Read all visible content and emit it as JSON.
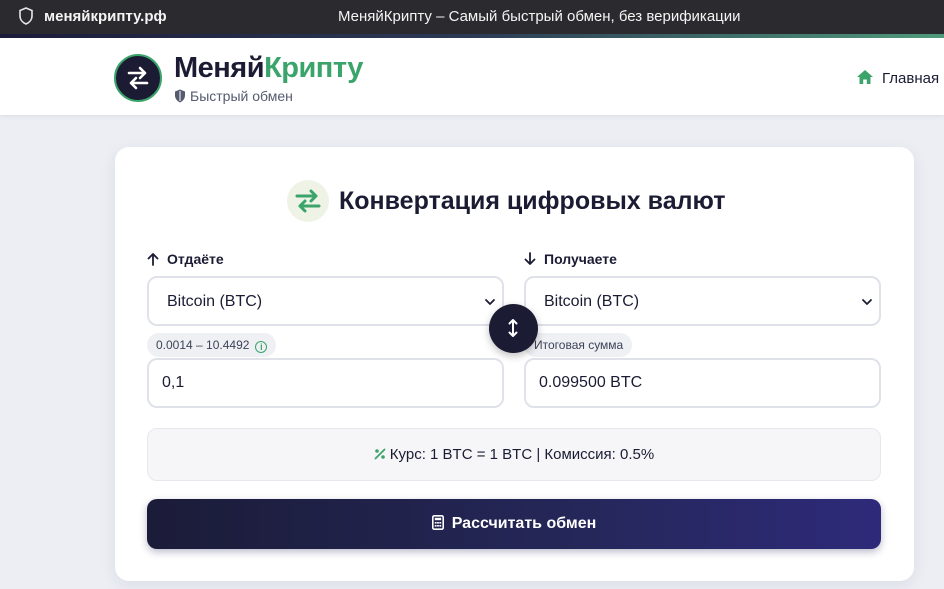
{
  "browser": {
    "url": "меняйкрипту.рф",
    "title": "МеняйКрипту – Самый быстрый обмен, без верификации"
  },
  "header": {
    "brand_part1": "Меняй",
    "brand_part2": "Крипту",
    "tagline": "Быстрый обмен",
    "nav_home": "Главная"
  },
  "card": {
    "title": "Конвертация цифровых валют",
    "give": {
      "label": "Отдаёте",
      "selected": "Bitcoin (BTC)",
      "range": "0.0014 – 10.4492",
      "amount": "0,1"
    },
    "receive": {
      "label": "Получаете",
      "selected": "Bitcoin (BTC)",
      "result_label": "Итоговая сумма",
      "amount": "0.099500 BTC"
    },
    "rate_text": "Курс: 1 BTC = 1 BTC | Комиссия: 0.5%",
    "calc_button": "Рассчитать обмен"
  },
  "icons": {
    "browser": "shield-icon",
    "logo": "exchange-arrows-icon",
    "tagline": "shield-icon",
    "nav": "home-icon",
    "title": "exchange-arrows-icon",
    "give": "arrow-up-icon",
    "receive": "arrow-down-icon",
    "swap": "swap-vertical-icon",
    "info": "info-icon",
    "rate": "percent-icon",
    "calc": "calculator-icon"
  },
  "colors": {
    "brand_dark": "#1b1c34",
    "brand_green": "#3aa46b"
  }
}
